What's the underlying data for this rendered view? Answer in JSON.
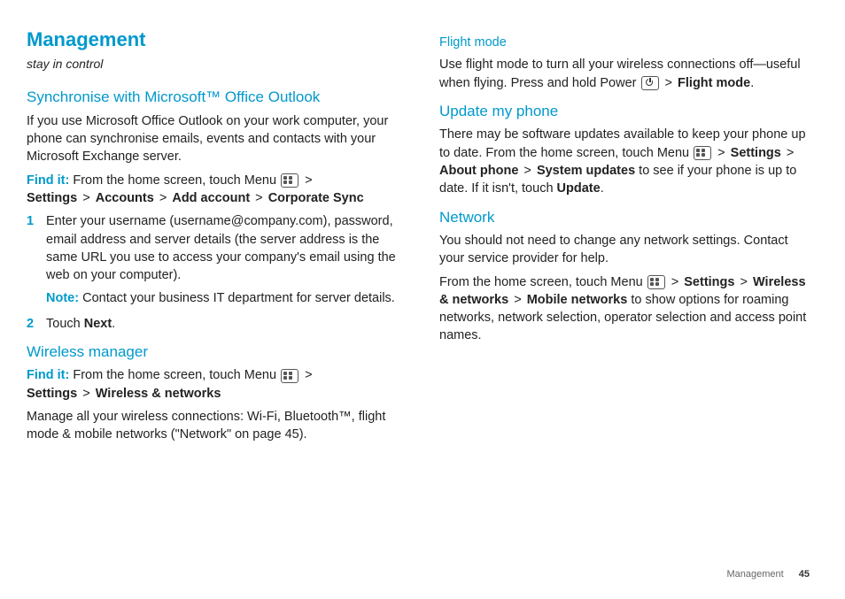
{
  "title": "Management",
  "tagline": "stay in control",
  "left": {
    "sync": {
      "head": "Synchronise with Microsoft™ Office Outlook",
      "intro": "If you use Microsoft Office Outlook on your work computer, your phone can synchronise emails, events and contacts with your Microsoft Exchange server.",
      "findit_label": "Find it:",
      "findit_pre": " From the home screen, touch Menu ",
      "gt": " > ",
      "path1": "Settings",
      "path2": "Accounts",
      "path3": "Add account",
      "path4": "Corporate Sync",
      "step1": "Enter your username (username@company.com), password, email address and server details (the server address is the same URL you use to access your company's email using the web on your computer).",
      "note_label": "Note:",
      "note_body": " Contact your business IT department for server details.",
      "step2_pre": "Touch ",
      "step2_bold": "Next",
      "step2_post": "."
    },
    "wireless": {
      "head": "Wireless manager",
      "findit_label": "Find it:",
      "findit_pre": " From the home screen, touch Menu ",
      "gt": " > ",
      "path1": "Settings",
      "path2": "Wireless & networks",
      "body": "Manage all your wireless connections: Wi-Fi, Bluetooth™, flight mode & mobile networks (\"Network\" on page 45)."
    }
  },
  "right": {
    "flight": {
      "head": "Flight mode",
      "body_pre": "Use flight mode to turn all your wireless connections off—useful when flying. Press and hold Power ",
      "gt": " > ",
      "bold": "Flight mode",
      "post": "."
    },
    "update": {
      "head": "Update my phone",
      "body_pre": "There may be software updates available to keep your phone up to date. From the home screen, touch Menu ",
      "gt": " > ",
      "p1": "Settings",
      "p2": "About phone",
      "p3": "System updates",
      "mid": " to see if your phone is up to date. If it isn't, touch ",
      "p4": "Update",
      "post": "."
    },
    "network": {
      "head": "Network",
      "body1": "You should not need to change any network settings. Contact your service provider for help.",
      "body2_pre": "From the home screen, touch Menu ",
      "gt": " > ",
      "p1": "Settings",
      "p2": "Wireless & networks",
      "p3": "Mobile networks",
      "post": " to show options for roaming networks, network selection, operator selection and access point names."
    }
  },
  "footer": {
    "section": "Management",
    "page": "45"
  }
}
